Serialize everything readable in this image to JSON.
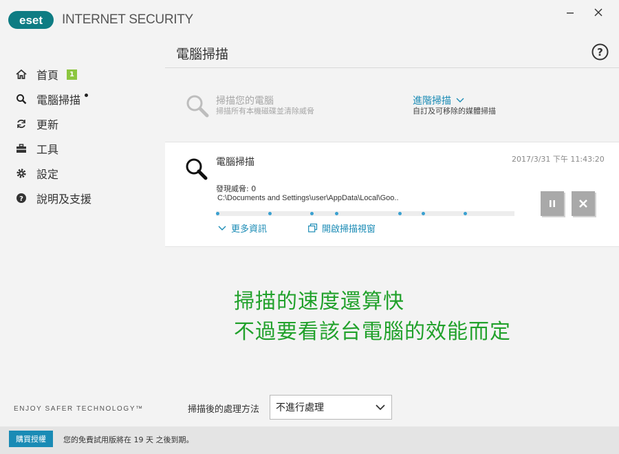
{
  "app": {
    "logo": "eset",
    "title": "INTERNET SECURITY"
  },
  "window": {
    "minimize_icon": "minimize-icon",
    "close_icon": "close-icon"
  },
  "sidebar": {
    "items": [
      {
        "label": "首頁",
        "icon": "home-icon",
        "badge": "1"
      },
      {
        "label": "電腦掃描",
        "icon": "search-icon",
        "active": true
      },
      {
        "label": "更新",
        "icon": "refresh-icon"
      },
      {
        "label": "工具",
        "icon": "toolbox-icon"
      },
      {
        "label": "設定",
        "icon": "gear-icon"
      },
      {
        "label": "說明及支援",
        "icon": "help-circle-icon"
      }
    ],
    "tagline": "ENJOY SAFER TECHNOLOGY™"
  },
  "main": {
    "title": "電腦掃描",
    "scan_pc": {
      "title": "掃描您的電腦",
      "desc": "掃描所有本機磁碟並清除威脅"
    },
    "advanced": {
      "title": "進階掃描",
      "desc": "自訂及可移除的媒體掃描"
    },
    "scan": {
      "title": "電腦掃描",
      "timestamp": "2017/3/31 下午 11:43:20",
      "threats": "發現威脅: 0",
      "current_file": "C:\\Documents and Settings\\user\\AppData\\Local\\Goo..",
      "more_info": "更多資訊",
      "open_window": "開啟掃描視窗"
    },
    "overlay": {
      "line1": "掃描的速度還算快",
      "line2": "不過要看該台電腦的效能而定"
    },
    "after_scan": {
      "label": "掃描後的處理方法",
      "value": "不進行處理"
    }
  },
  "footer": {
    "buy_label": "購買授權",
    "trial_text": "您的免費試用版將在 19 天 之後到期。"
  },
  "colors": {
    "accent": "#1a8bb5",
    "badge": "#8cc63f",
    "overlay_text": "#21a12b",
    "button_gray": "#a9a9a9"
  }
}
